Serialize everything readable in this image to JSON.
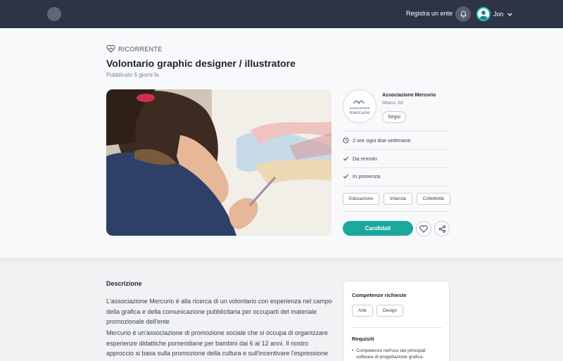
{
  "nav": {
    "register_label": "Registra un ente",
    "user_name": "Jon",
    "bell_icon": "bell-icon",
    "chevron_icon": "chevron-down-icon"
  },
  "opportunity": {
    "badge": "RICORRENTE",
    "badge_icon": "recurring-heart-icon",
    "title": "Volontario graphic designer / illustratore",
    "published": "Pubblicato 5 giorni fa"
  },
  "organization": {
    "logo_text_top": "associazione",
    "logo_text_bottom": "mercurio",
    "name": "Associazione Mercurio",
    "city": "Milano, MI",
    "follow_label": "Segui"
  },
  "details": [
    {
      "icon": "clock-icon",
      "text": "2 ore ogni due settimane"
    },
    {
      "icon": "check-icon",
      "text": "Da remoto"
    },
    {
      "icon": "check-icon",
      "text": "In presenza"
    }
  ],
  "tags": [
    "Educazione",
    "Infanzia",
    "Collettività"
  ],
  "actions": {
    "apply_label": "Candidati",
    "favorite_icon": "heart-icon",
    "share_icon": "share-icon"
  },
  "description": {
    "heading": "Descrizione",
    "paragraphs": [
      "L'associazione Mercurio è alla ricerca di un volontario con esperienza nel campo della grafica e della comunicazione pubblicitaria per occuparti del materiale promozionale dell'ente",
      "Mercurio è un'associazione di promozione sociale che si occupa di organizzare esperienze didattiche pomeridiane per bambini dai 6 ai 12 anni. Il nostro approccio si basa sulla promozione della cultura e sull'incentivare l'espressione artistica nei bambini."
    ]
  },
  "sidebar": {
    "skills_title": "Competenze richieste",
    "skills": [
      "Arte",
      "Design"
    ],
    "requirements_title": "Requisiti",
    "requirements": [
      "Competenze nell'uso dei principali software di progettazione grafica."
    ]
  },
  "colors": {
    "navbar": "#2d3446",
    "accent": "#1aa99c",
    "avatar_ring": "#19c3b5"
  }
}
